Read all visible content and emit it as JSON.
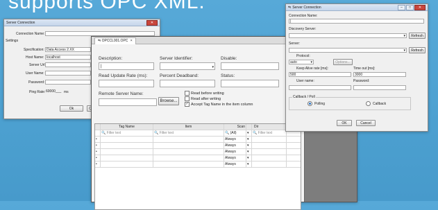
{
  "headline": "supports OPC XML.",
  "win1": {
    "title": "Server Connection",
    "close_glyph": "✕",
    "connection_name_label": "Connection Name:",
    "connection_name_value": "",
    "settings_label": "Settings",
    "specification_label": "Specification:",
    "specification_value": "Data Access 2.XX",
    "host_label": "Host Name:",
    "host_value": "localhost",
    "server_url_label": "Server Url:",
    "user_label": "User Name:",
    "password_label": "Password:",
    "ping_label": "Ping Rate:",
    "ping_value": "60000___",
    "ping_unit": "ms",
    "ok_label": "Ok",
    "cancel_partial": "C"
  },
  "win2": {
    "tab_label": "OPCCL001.OPC",
    "tab_close": "×",
    "description_label": "Description:",
    "server_identifier_label": "Server Identifier:",
    "disable_label": "Disable:",
    "read_update_label": "Read Update Rate (ms):",
    "percent_deadband_label": "Percent Deadband:",
    "status_label": "Status:",
    "remote_server_label": "Remote Server Name:",
    "browse_label": "Browse...",
    "checks": [
      {
        "label": "Read before writing",
        "checked": false
      },
      {
        "label": "Read after writing",
        "checked": false
      },
      {
        "label": "Accept Tag Name in the item column",
        "checked": true
      }
    ],
    "grid": {
      "headers": [
        "",
        "Tag Name",
        "Item",
        "Scan",
        "",
        "Dir"
      ],
      "filter_text": "Filter text",
      "scan_filter": "(All)",
      "rows": [
        "Always",
        "Always",
        "Always",
        "Always",
        "Always"
      ]
    }
  },
  "win3": {
    "title": "Server Connection",
    "close_glyph": "✕",
    "connection_name_label": "Connection Name:",
    "discovery_label": "Discovery Server:",
    "refresh1_label": "Refresh",
    "server_label": "Server:",
    "refresh2_label": "Refresh",
    "protocol_label": "Protocol:",
    "protocol_value": "auto",
    "options_label": "Options...",
    "keepalive_label": "Keep Alive rate [ms]:",
    "keepalive_value": "500",
    "timeout_label": "Time out [ms]:",
    "timeout_value": "3000",
    "user_label": "User name:",
    "password_label": "Password:",
    "callback_group_label": "Callback / Poll",
    "polling_label": "Polling",
    "callback_label": "Callback",
    "ok_label": "OK",
    "cancel_label": "Cancel"
  }
}
